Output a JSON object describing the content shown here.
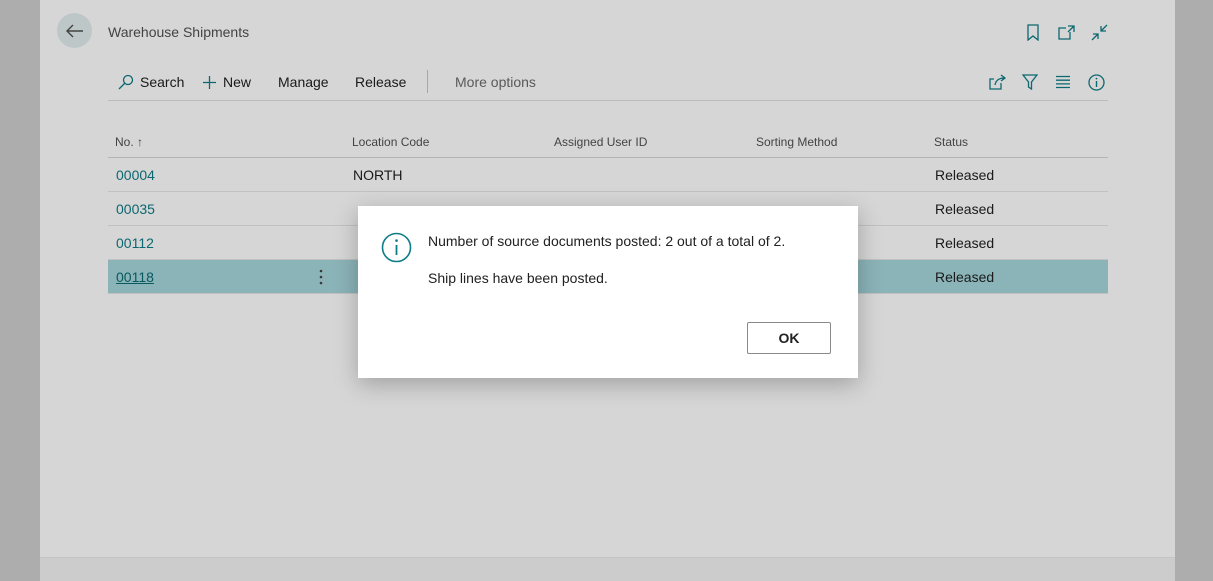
{
  "header": {
    "title": "Warehouse Shipments",
    "icons": [
      "bookmark-icon",
      "open-new-window-icon",
      "collapse-icon"
    ]
  },
  "actionbar": {
    "search": "Search",
    "new": "New",
    "manage": "Manage",
    "release": "Release",
    "more_options": "More options",
    "icons": [
      "share-icon",
      "filter-icon",
      "list-view-icon",
      "info-icon"
    ]
  },
  "table": {
    "columns": [
      "No. ↑",
      "Location Code",
      "Assigned User ID",
      "Sorting Method",
      "Status"
    ],
    "rows": [
      {
        "no": "00004",
        "location": "NORTH",
        "user": "",
        "sorting": "",
        "status": "Released"
      },
      {
        "no": "00035",
        "location": "",
        "user": "",
        "sorting": "",
        "status": "Released"
      },
      {
        "no": "00112",
        "location": "",
        "user": "",
        "sorting": "",
        "status": "Released"
      },
      {
        "no": "00118",
        "location": "",
        "user": "",
        "sorting": "",
        "status": "Released"
      }
    ]
  },
  "dialog": {
    "message1": "Number of source documents posted: 2 out of a total of 2.",
    "message2": "Ship lines have been posted.",
    "ok_label": "OK"
  },
  "colors": {
    "accent": "#0e7c86",
    "selected_row": "#a6d7dc"
  }
}
